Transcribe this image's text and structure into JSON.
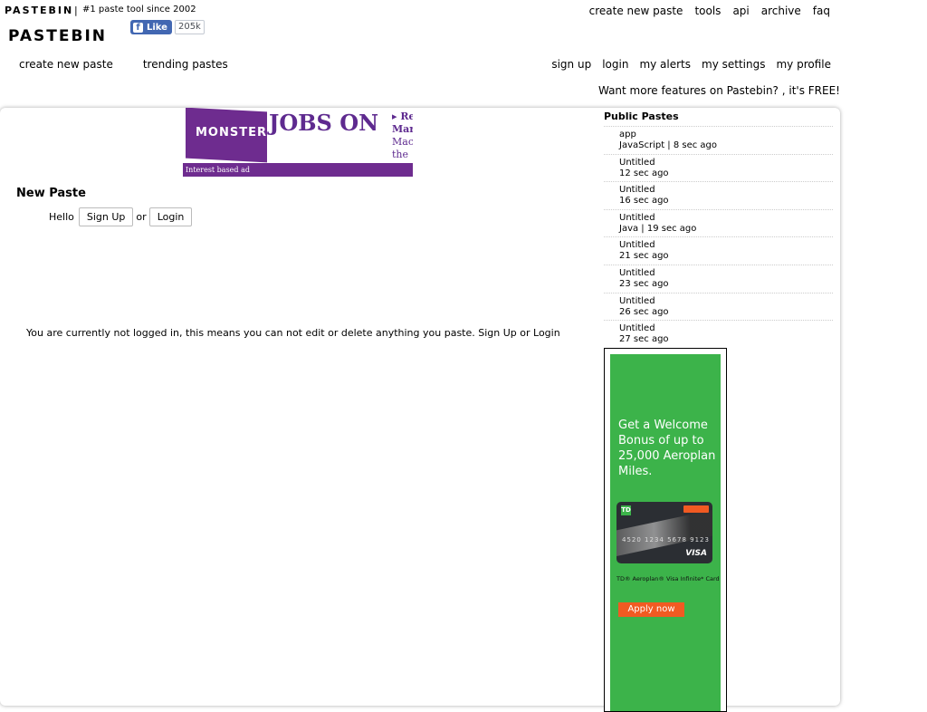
{
  "brand": {
    "small_name": "PASTEBIN",
    "separator": "|",
    "tagline": "#1 paste tool since 2002",
    "logo": "PASTEBIN"
  },
  "facebook": {
    "like_label": "Like",
    "count": "205k",
    "icon": "facebook-icon",
    "brand_color": "#4267b2"
  },
  "top_links": [
    "create new paste",
    "tools",
    "api",
    "archive",
    "faq"
  ],
  "nav_left": [
    "create new paste",
    "trending pastes"
  ],
  "nav_right": [
    "sign up",
    "login",
    "my alerts",
    "my settings",
    "my profile"
  ],
  "promo": "Want more features on Pastebin? , it's FREE!",
  "top_ad": {
    "brand": "MONSTER",
    "headline": "JOBS ON",
    "side_lines": [
      "▸ Re",
      "Mar",
      "Mac",
      "the"
    ],
    "footer": "Interest based ad",
    "color": "#6e2c8f"
  },
  "main": {
    "title": "New Paste",
    "hello": "Hello",
    "signup_button": "Sign Up",
    "or": "or",
    "login_button": "Login",
    "notice": "You are currently not logged in, this means you can not edit or delete anything you paste. Sign Up or Login"
  },
  "public_pastes": {
    "title": "Public Pastes",
    "items": [
      {
        "name": "app",
        "meta": "JavaScript | 8 sec ago"
      },
      {
        "name": "Untitled",
        "meta": "12 sec ago"
      },
      {
        "name": "Untitled",
        "meta": "16 sec ago"
      },
      {
        "name": "Untitled",
        "meta": "Java | 19 sec ago"
      },
      {
        "name": "Untitled",
        "meta": "21 sec ago"
      },
      {
        "name": "Untitled",
        "meta": "23 sec ago"
      },
      {
        "name": "Untitled",
        "meta": "26 sec ago"
      },
      {
        "name": "Untitled",
        "meta": "27 sec ago"
      }
    ]
  },
  "side_ad": {
    "text": "Get a Welcome Bonus of up to 25,000 Aeroplan Miles.",
    "card_logo": "TD",
    "card_number": "4520 1234 5678 9123",
    "card_network": "VISA",
    "card_caption": "TD® Aeroplan® Visa Infinite* Card",
    "button": "Apply now",
    "background_color": "#3cb34a",
    "button_color": "#f15a22"
  }
}
